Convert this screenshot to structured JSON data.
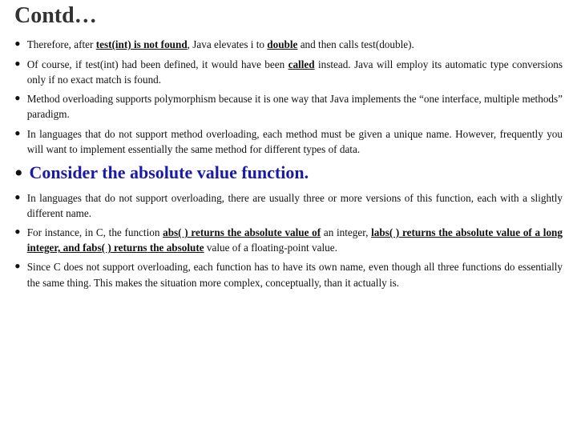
{
  "title": "Contd…",
  "bullets_top": [
    {
      "id": "b1",
      "text_parts": [
        {
          "text": "Therefore, after ",
          "style": "normal"
        },
        {
          "text": "test(int) is not found",
          "style": "bold-underline"
        },
        {
          "text": ", Java elevates i to ",
          "style": "normal"
        },
        {
          "text": "double",
          "style": "bold-underline"
        },
        {
          "text": " and then calls test(double).",
          "style": "normal"
        }
      ]
    },
    {
      "id": "b2",
      "text_parts": [
        {
          "text": "Of course, if test(int) had been defined, it would have been ",
          "style": "normal"
        },
        {
          "text": "called",
          "style": "bold-underline"
        },
        {
          "text": " instead. Java will employ its automatic type conversions only if no exact match is found.",
          "style": "normal"
        }
      ]
    },
    {
      "id": "b3",
      "text_parts": [
        {
          "text": "Method overloading supports polymorphism because it is one way that Java implements the “one interface, multiple methods” paradigm.",
          "style": "normal"
        }
      ]
    },
    {
      "id": "b4",
      "text_parts": [
        {
          "text": "In languages that do not support method overloading, each method must be given a unique name. However, frequently you will want to implement essentially the same method for different types of data.",
          "style": "normal"
        }
      ]
    }
  ],
  "highlight": {
    "text": "Consider the absolute value function."
  },
  "bullets_bottom": [
    {
      "id": "b5",
      "text_parts": [
        {
          "text": "In languages that do not support overloading, there are usually three or more versions of this function, each with a slightly different name.",
          "style": "normal"
        }
      ]
    },
    {
      "id": "b6",
      "text_parts": [
        {
          "text": "For instance, in C, the function ",
          "style": "normal"
        },
        {
          "text": "abs( ) returns the absolute value of",
          "style": "bold-underline"
        },
        {
          "text": " an integer, ",
          "style": "normal"
        },
        {
          "text": "labs( ) returns the absolute value of a long integer, and fabs( ) returns the absolute",
          "style": "bold-underline"
        },
        {
          "text": " value of a floating-point value.",
          "style": "normal"
        }
      ]
    },
    {
      "id": "b7",
      "text_parts": [
        {
          "text": "Since C does not support overloading, each function has to have its own name, even though all three functions do essentially the same thing. This makes the situation more complex, conceptually, than it actually is.",
          "style": "normal"
        }
      ]
    }
  ]
}
